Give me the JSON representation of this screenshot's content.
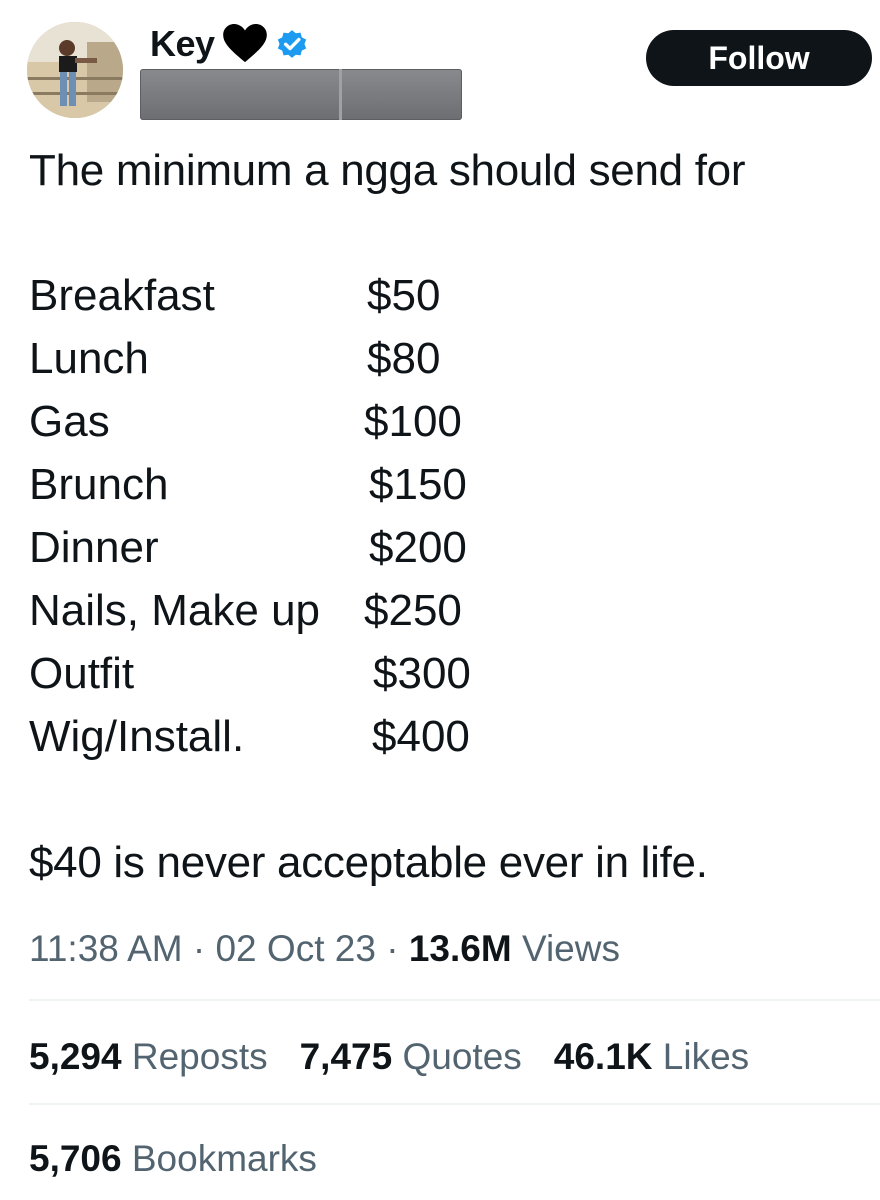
{
  "user": {
    "name": "Key",
    "heart_icon": "black-heart-icon",
    "badge_icon": "verified-badge-icon",
    "badge_color": "#1d9bf0"
  },
  "follow_label": "Follow",
  "tweet": {
    "intro": "The minimum a ngga should send for",
    "prices": [
      {
        "label": "Breakfast",
        "amount": "$50"
      },
      {
        "label": "Lunch",
        "amount": "$80"
      },
      {
        "label": "Gas",
        "amount": "$100"
      },
      {
        "label": "Brunch",
        "amount": "$150"
      },
      {
        "label": "Dinner",
        "amount": "$200"
      },
      {
        "label": "Nails, Make up",
        "amount": "$250"
      },
      {
        "label": "Outfit",
        "amount": "$300"
      },
      {
        "label": "Wig/Install.",
        "amount": "$400"
      }
    ],
    "closing": "$40 is never acceptable ever in life."
  },
  "meta": {
    "time": "11:38 AM",
    "date": "02 Oct 23",
    "views_count": "13.6M",
    "views_label": "Views"
  },
  "stats": {
    "reposts_count": "5,294",
    "reposts_label": "Reposts",
    "quotes_count": "7,475",
    "quotes_label": "Quotes",
    "likes_count": "46.1K",
    "likes_label": "Likes",
    "bookmarks_count": "5,706",
    "bookmarks_label": "Bookmarks"
  },
  "colors": {
    "text": "#0f1419",
    "secondary": "#536471",
    "divider": "#eff3f4",
    "button_bg": "#0f1419"
  }
}
